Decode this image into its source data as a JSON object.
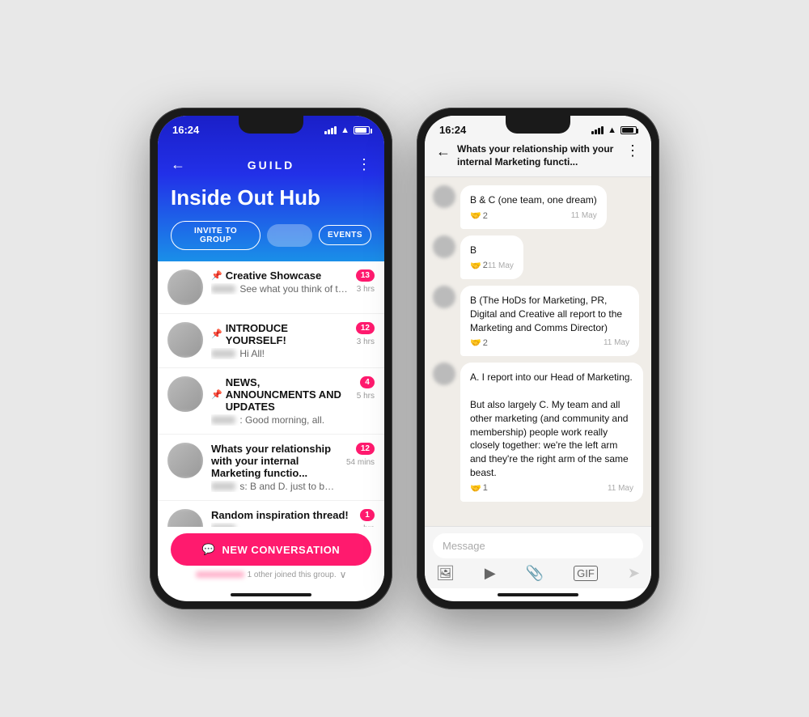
{
  "phones": {
    "left": {
      "status": {
        "time": "16:24"
      },
      "header": {
        "back": "←",
        "logo": "GUILD",
        "more": "⋮",
        "title": "Inside Out Hub",
        "invite_label": "INVITE TO GROUP",
        "events_label": "EVENTS"
      },
      "conversations": [
        {
          "id": 1,
          "title": "Creative Showcase",
          "preview": "See what you think of the...",
          "time": "3 hrs",
          "badge": "13",
          "pinned": true
        },
        {
          "id": 2,
          "title": "INTRODUCE YOURSELF!",
          "preview": "Hi All!",
          "time": "3 hrs",
          "badge": "12",
          "pinned": true
        },
        {
          "id": 3,
          "title": "NEWS, ANNOUNCMENTS AND UPDATES",
          "preview": ": Good morning, all.",
          "time": "5 hrs",
          "badge": "4",
          "pinned": true
        },
        {
          "id": 4,
          "title": "Whats your relationship with your internal Marketing functio...",
          "preview": "s: B and D. just to be awkwa...",
          "time": "54 mins",
          "badge": "12",
          "pinned": false
        },
        {
          "id": 5,
          "title": "Random inspiration thread!",
          "preview": "",
          "time": "hrs",
          "badge": "1",
          "pinned": false
        }
      ],
      "fab": {
        "icon": "💬",
        "label": "NEW CONVERSATION"
      },
      "joined_notice": "1 other joined this group."
    },
    "right": {
      "status": {
        "time": "16:24"
      },
      "header": {
        "back": "←",
        "title": "Whats your relationship with your internal Marketing functi...",
        "more": "⋮"
      },
      "messages": [
        {
          "id": 1,
          "text": "B & C (one team, one dream)",
          "time": "11 May",
          "reaction": "🤝",
          "reaction_count": "2"
        },
        {
          "id": 2,
          "text": "B",
          "time": "11 May",
          "reaction": "🤝",
          "reaction_count": "2"
        },
        {
          "id": 3,
          "text": "B  (The HoDs for Marketing, PR, Digital and Creative all report to the Marketing and Comms Director)",
          "time": "11 May",
          "reaction": "🤝",
          "reaction_count": "2"
        },
        {
          "id": 4,
          "text": "A. I report into our Head of Marketing.\n\nBut also largely C. My team and all other marketing (and community and membership) people work really closely together: we're the left arm and they're the right arm of the same beast.",
          "time": "11 May",
          "reaction": "🤝",
          "reaction_count": "1"
        }
      ],
      "input": {
        "placeholder": "Message"
      }
    }
  }
}
